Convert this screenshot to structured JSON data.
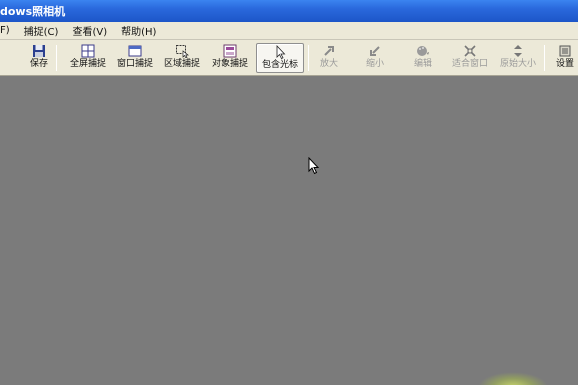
{
  "window": {
    "title": "dows照相机"
  },
  "menu": [
    {
      "label": "F)"
    },
    {
      "label": "捕捉(C)"
    },
    {
      "label": "查看(V)"
    },
    {
      "label": "帮助(H)"
    }
  ],
  "toolbar": {
    "save": "保存",
    "full_screen": "全屏捕捉",
    "window_capture": "窗口捕捉",
    "region_capture": "区域捕捉",
    "object_capture": "对象捕捉",
    "include_cursor": "包含光标",
    "zoom_in": "放大",
    "zoom_out": "缩小",
    "edit": "编辑",
    "fit_window": "适合窗口",
    "original_size": "原始大小",
    "settings": "设置"
  },
  "colors": {
    "titlebar": "#2a68dc",
    "chrome": "#ece9d8",
    "canvas": "#7b7b7b"
  }
}
